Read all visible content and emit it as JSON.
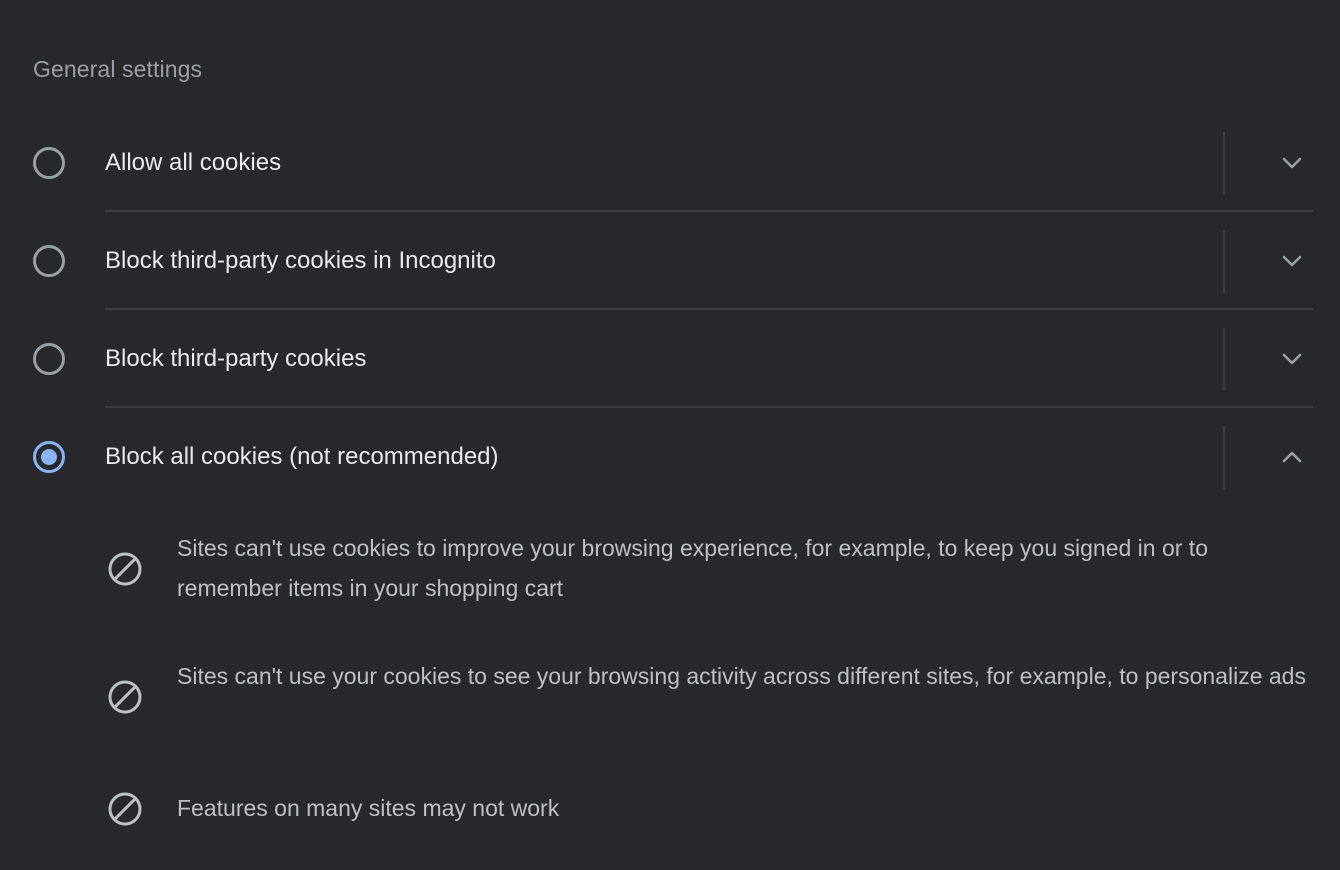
{
  "section_title": "General settings",
  "options": [
    {
      "label": "Allow all cookies",
      "selected": false,
      "expanded": false
    },
    {
      "label": "Block third-party cookies in Incognito",
      "selected": false,
      "expanded": false
    },
    {
      "label": "Block third-party cookies",
      "selected": false,
      "expanded": false
    },
    {
      "label": "Block all cookies (not recommended)",
      "selected": true,
      "expanded": true
    }
  ],
  "details": [
    {
      "text": "Sites can't use cookies to improve your browsing experience, for example, to keep you signed in or to remember items in your shopping cart",
      "icon": "block-icon"
    },
    {
      "text": "Sites can't use your cookies to see your browsing activity across different sites, for example, to personalize ads",
      "icon": "block-icon"
    },
    {
      "text": "Features on many sites may not work",
      "icon": "block-icon"
    }
  ],
  "colors": {
    "background": "#28282d",
    "accent": "#8ab4f8",
    "primary_text": "#e8eaed",
    "secondary_text": "#bdc1c6",
    "divider": "#3c3c41"
  }
}
